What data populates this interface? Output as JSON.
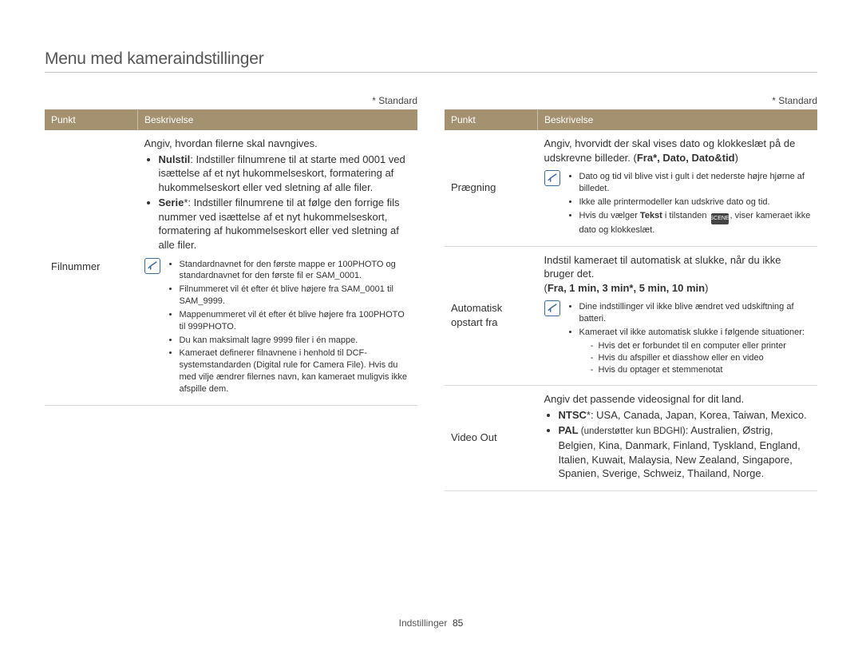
{
  "heading": "Menu med kameraindstillinger",
  "std_marker": "* Standard",
  "footer": {
    "section": "Indstillinger",
    "page": "85"
  },
  "headers": {
    "punkt": "Punkt",
    "besk": "Beskrivelse"
  },
  "left": {
    "row1": {
      "label": "Filnummer",
      "intro": "Angiv, hvordan filerne skal navngives.",
      "b1_head": "Nulstil",
      "b1_rest": ": Indstiller filnumrene til at starte med 0001 ved isættelse af et nyt hukommelseskort, formatering af hukommelseskort eller ved sletning af alle filer.",
      "b2_head": "Serie",
      "b2_rest": "*: Indstiller filnumrene til at følge den forrige fils nummer ved isættelse af et nyt hukommelseskort, formatering af hukommelseskort eller ved sletning af alle filer.",
      "note_items": [
        "Standardnavnet for den første mappe er 100PHOTO og standardnavnet for den første fil er SAM_0001.",
        "Filnummeret vil ét efter ét blive højere fra SAM_0001 til SAM_9999.",
        "Mappenummeret vil ét efter ét blive højere fra 100PHOTO til 999PHOTO.",
        "Du kan maksimalt lagre 9999 filer i én mappe.",
        "Kameraet definerer filnavnene i henhold til DCF-systemstandarden (Digital rule for Camera File). Hvis du med vilje ændrer filernes navn, kan kameraet muligvis ikke afspille dem."
      ]
    }
  },
  "right": {
    "row1": {
      "label": "Prægning",
      "intro_a": "Angiv, hvorvidt der skal vises dato og klokkeslæt på de udskrevne billeder. (",
      "intro_opts": "Fra*, Dato, Dato&tid",
      "intro_b": ")",
      "note_items_pre": [
        "Dato og tid vil blive vist i gult i det nederste højre hjørne af billedet.",
        "Ikke alle printermodeller kan udskrive dato og tid."
      ],
      "note_item_tekst_a": "Hvis du vælger ",
      "note_item_tekst_b": "Tekst",
      "note_item_tekst_c": " i tilstanden ",
      "note_item_tekst_d": ", viser kameraet ikke dato og klokkeslæt.",
      "scene_badge": "SCENE"
    },
    "row2": {
      "label": "Automatisk opstart fra",
      "intro": "Indstil kameraet til automatisk at slukke, når du ikke bruger det.",
      "opts_a": "(",
      "opts_bold": "Fra, 1 min, 3 min*, 5 min, 10 min",
      "opts_b": ")",
      "note_items": [
        "Dine indstillinger vil ikke blive ændret ved udskiftning af batteri."
      ],
      "note_item2_intro": "Kameraet vil ikke automatisk slukke i følgende situationer:",
      "note_item2_sub": [
        "Hvis det er forbundet til en computer eller printer",
        "Hvis du afspiller et diasshow eller en video",
        "Hvis du optager et stemmenotat"
      ]
    },
    "row3": {
      "label": "Video Out",
      "intro": "Angiv det passende videosignal for dit land.",
      "b1_head": "NTSC",
      "b1_rest": "*: USA, Canada, Japan, Korea, Taiwan, Mexico.",
      "b2_head": "PAL",
      "b2_small": " (understøtter kun BDGHI)",
      "b2_rest": ": Australien, Østrig, Belgien, Kina, Danmark, Finland, Tyskland, England, Italien, Kuwait, Malaysia, New Zealand, Singapore, Spanien, Sverige, Schweiz, Thailand, Norge."
    }
  }
}
